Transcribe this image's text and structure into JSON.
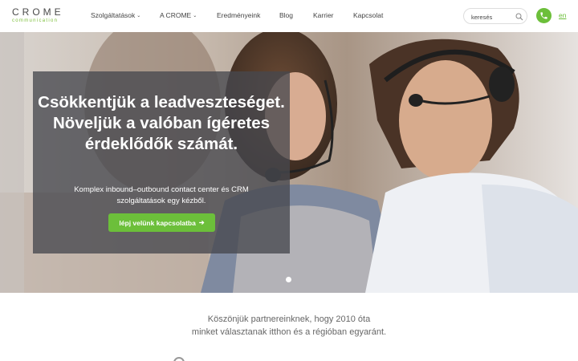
{
  "logo": {
    "main": "CROME",
    "sub": "communication"
  },
  "nav": {
    "items": [
      {
        "label": "Szolgáltatások",
        "dropdown": true
      },
      {
        "label": "A CROME",
        "dropdown": true
      },
      {
        "label": "Eredményeink",
        "dropdown": false
      },
      {
        "label": "Blog",
        "dropdown": false
      },
      {
        "label": "Karrier",
        "dropdown": false
      },
      {
        "label": "Kapcsolat",
        "dropdown": false
      }
    ],
    "search_placeholder": "keresés",
    "language": "en",
    "dropdown_glyph": "⌄"
  },
  "hero": {
    "title": "Csökkentjük a leadveszteséget. Növeljük a valóban ígéretes érdeklődők számát.",
    "subtitle": "Komplex inbound–outbound contact center és CRM szolgáltatások egy kézből.",
    "cta_label": "lépj velünk kapcsolatba",
    "cta_arrow": "➔"
  },
  "partners": {
    "line1": "Köszönjük partnereinknek, hogy 2010 óta",
    "line2": "minket választanak itthon és a régióban egyaránt."
  },
  "colors": {
    "accent": "#6cbf3a",
    "overlay": "#46484e",
    "text": "#444444"
  },
  "icons": {
    "search": "search-icon",
    "phone": "phone-icon"
  }
}
